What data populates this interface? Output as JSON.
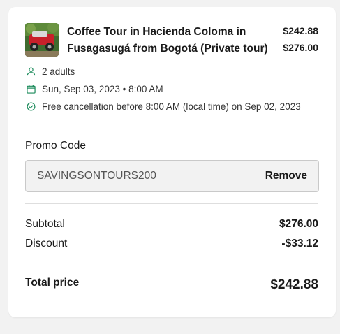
{
  "tour": {
    "title": "Coffee Tour in Hacienda Coloma in Fusagasugá from Bogotá (Private tour)",
    "price_now": "$242.88",
    "price_old": "$276.00",
    "thumbnail_icon": "tour-thumbnail"
  },
  "details": {
    "travelers": "2 adults",
    "date": "Sun, Sep 03, 2023 • 8:00 AM",
    "cancellation": "Free cancellation before 8:00 AM (local time) on Sep 02, 2023"
  },
  "promo": {
    "label": "Promo Code",
    "code": "SAVINGSONTOURS200",
    "remove_label": "Remove"
  },
  "summary": {
    "subtotal_label": "Subtotal",
    "subtotal_value": "$276.00",
    "discount_label": "Discount",
    "discount_value": "-$33.12",
    "total_label": "Total price",
    "total_value": "$242.88"
  },
  "colors": {
    "icon_green": "#1a8a5a",
    "card_bg": "#ffffff",
    "page_bg": "#f2f2f2"
  }
}
